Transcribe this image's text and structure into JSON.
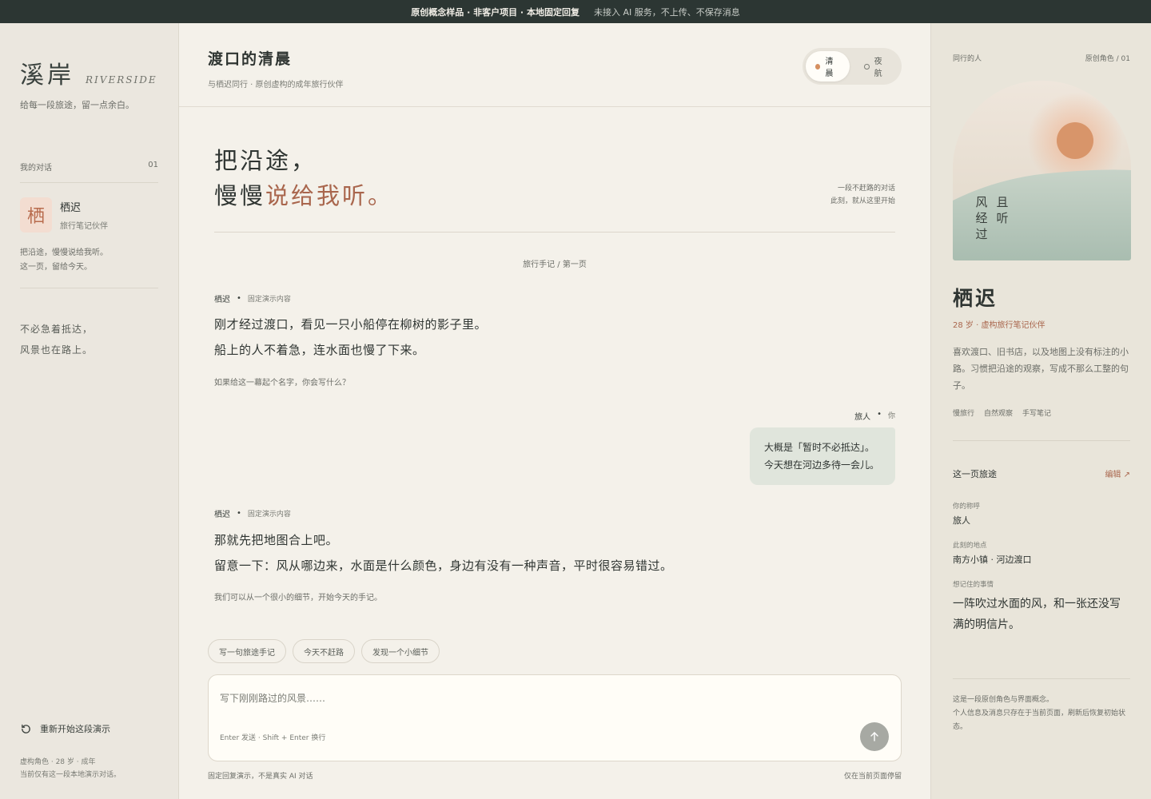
{
  "banner": {
    "main": "原创概念样品 · 非客户项目 · 本地固定回复",
    "note": "未接入 AI 服务，不上传、不保存消息"
  },
  "sidebar": {
    "brand_cn": "溪岸",
    "brand_en": "RIVERSIDE",
    "tagline": "给每一段旅途，留一点余白。",
    "conversations_label": "我的对话",
    "conversations_count": "01",
    "contact": {
      "avatar_char": "栖",
      "name": "栖迟",
      "subtitle": "旅行笔记伙伴",
      "preview_line1": "把沿途，慢慢说给我听。",
      "preview_line2": "这一页，留给今天。"
    },
    "quote_line1": "不必急着抵达，",
    "quote_line2": "风景也在路上。",
    "restart_label": "重新开始这段演示",
    "footer_line1": "虚构角色 · 28 岁 · 成年",
    "footer_line2": "当前仅有这一段本地演示对话。"
  },
  "header": {
    "title": "渡口的清晨",
    "subtitle": "与栖迟同行 · 原创虚构的成年旅行伙伴",
    "mode_morning": "清晨",
    "mode_night": "夜航"
  },
  "hero": {
    "line1": "把沿途，",
    "line2_plain": "慢慢",
    "line2_accent": "说给我听。",
    "note_line1": "一段不赶路的对话",
    "note_line2": "此刻，就从这里开始",
    "page_label": "旅行手记 / 第一页"
  },
  "messages": [
    {
      "sender": "栖迟",
      "tag": "固定演示内容",
      "line1": "刚才经过渡口，看见一只小船停在柳树的影子里。",
      "line2": "船上的人不着急，连水面也慢了下来。",
      "hint": "如果给这一幕起个名字，你会写什么？"
    },
    {
      "sender": "栖迟",
      "tag": "固定演示内容",
      "line1": "那就先把地图合上吧。",
      "line2": "留意一下：风从哪边来，水面是什么颜色，身边有没有一种声音，平时很容易错过。",
      "hint": "我们可以从一个很小的细节，开始今天的手记。"
    }
  ],
  "user_message": {
    "sender": "旅人",
    "tag": "你",
    "line1": "大概是「暂时不必抵达」。",
    "line2": "今天想在河边多待一会儿。"
  },
  "chips": [
    "写一句旅途手记",
    "今天不赶路",
    "发现一个小细节"
  ],
  "composer": {
    "placeholder": "写下刚刚路过的风景……",
    "hint": "Enter 发送 · Shift + Enter 换行",
    "footer_left": "固定回复演示，不是真实 AI 对话",
    "footer_right": "仅在当前页面停留"
  },
  "profile": {
    "companion_label": "同行的人",
    "role_label": "原创角色 / 01",
    "poem_col1": "且听",
    "poem_col2": "风经过",
    "name": "栖迟",
    "subtitle": "28 岁 · 虚构旅行笔记伙伴",
    "description": "喜欢渡口、旧书店，以及地图上没有标注的小路。习惯把沿途的观察，写成不那么工整的句子。",
    "tags": [
      "慢旅行",
      "自然观察",
      "手写笔记"
    ],
    "journey_title": "这一页旅途",
    "edit_label": "编辑 ↗",
    "fields": {
      "nickname_label": "你的称呼",
      "nickname_value": "旅人",
      "location_label": "此刻的地点",
      "location_value": "南方小镇 · 河边渡口",
      "memory_label": "想记住的事情",
      "memory_value": "一阵吹过水面的风，和一张还没写满的明信片。"
    },
    "footer_line1": "这是一段原创角色与界面概念。",
    "footer_line2": "个人信息及消息只存在于当前页面，刷新后恢复初始状态。"
  },
  "colors": {
    "banner_bg": "#2c3633",
    "accent": "#a9664d",
    "sun": "#d58f5f",
    "user_bubble": "#e0e5dc"
  }
}
